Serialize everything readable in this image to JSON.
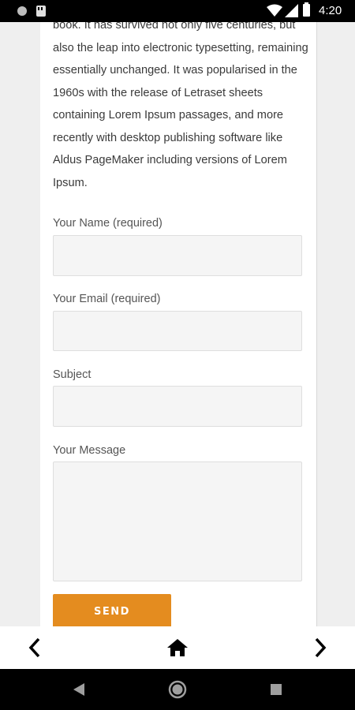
{
  "status_bar": {
    "time": "4:20",
    "icons": [
      "notification-dot-icon",
      "sd-card-icon",
      "wifi-icon",
      "signal-icon",
      "battery-icon"
    ]
  },
  "content": {
    "intro_text": "book. It has survived not only five centuries, but also the leap into electronic typesetting, remaining essentially unchanged. It was popularised in the 1960s with the release of Letraset sheets containing Lorem Ipsum passages, and more recently with desktop publishing software like Aldus PageMaker including versions of Lorem Ipsum."
  },
  "form": {
    "name_label": "Your Name (required)",
    "name_value": "",
    "email_label": "Your Email (required)",
    "email_value": "",
    "subject_label": "Subject",
    "subject_value": "",
    "message_label": "Your Message",
    "message_value": "",
    "send_label": "SEND"
  },
  "app_nav": {
    "icons": [
      "chevron-left-icon",
      "home-icon",
      "chevron-right-icon"
    ]
  },
  "system_nav": {
    "icons": [
      "back-triangle-icon",
      "home-circle-icon",
      "recents-square-icon"
    ]
  },
  "colors": {
    "accent": "#e48c1f",
    "background": "#efefef",
    "input_bg": "#f5f5f5"
  }
}
